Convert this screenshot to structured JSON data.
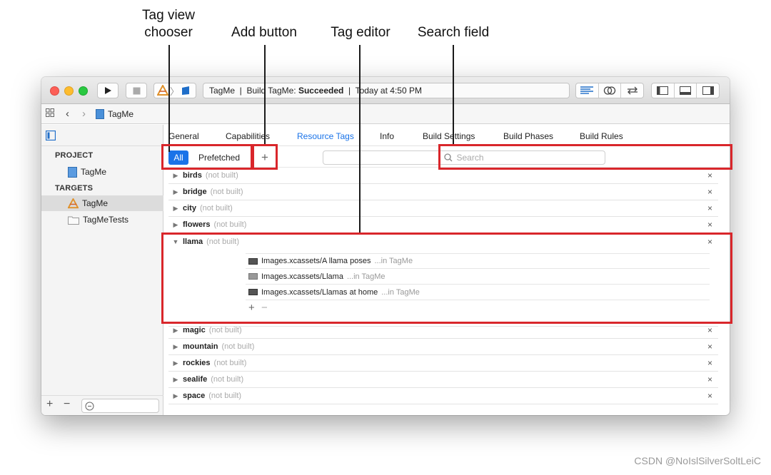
{
  "callouts": {
    "tag_view_chooser": "Tag view\nchooser",
    "add_button": "Add button",
    "tag_editor": "Tag editor",
    "search_field": "Search field"
  },
  "toolbar": {
    "scheme": "TagMe",
    "activity_prefix": "TagMe  |  Build TagMe: ",
    "activity_status": "Succeeded",
    "activity_suffix": "  |  Today at 4:50 PM"
  },
  "navbar": {
    "file": "TagMe"
  },
  "sidebar": {
    "sections": [
      {
        "title": "PROJECT",
        "items": [
          "TagMe"
        ]
      },
      {
        "title": "TARGETS",
        "items": [
          "TagMe",
          "TagMeTests"
        ]
      }
    ],
    "footer": {
      "add": "+",
      "remove": "−"
    }
  },
  "tabs": [
    "General",
    "Capabilities",
    "Resource Tags",
    "Info",
    "Build Settings",
    "Build Phases",
    "Build Rules"
  ],
  "active_tab": "Resource Tags",
  "filter": {
    "all": "All",
    "prefetched": "Prefetched",
    "add": "+",
    "search_placeholder": "Search"
  },
  "tags": [
    {
      "name": "birds",
      "status": "(not built)",
      "expanded": false
    },
    {
      "name": "bridge",
      "status": "(not built)",
      "expanded": false
    },
    {
      "name": "city",
      "status": "(not built)",
      "expanded": false
    },
    {
      "name": "flowers",
      "status": "(not built)",
      "expanded": false
    },
    {
      "name": "llama",
      "status": "(not built)",
      "expanded": true
    },
    {
      "name": "magic",
      "status": "(not built)",
      "expanded": false
    },
    {
      "name": "mountain",
      "status": "(not built)",
      "expanded": false
    },
    {
      "name": "rockies",
      "status": "(not built)",
      "expanded": false
    },
    {
      "name": "sealife",
      "status": "(not built)",
      "expanded": false
    },
    {
      "name": "space",
      "status": "(not built)",
      "expanded": false
    }
  ],
  "remove_glyph": "×",
  "llama_assets": [
    {
      "path": "Images.xcassets/A llama poses",
      "where": "...in TagMe"
    },
    {
      "path": "Images.xcassets/Llama",
      "where": "...in TagMe"
    },
    {
      "path": "Images.xcassets/Llamas at home",
      "where": "...in TagMe"
    }
  ],
  "asset_controls": {
    "add": "+",
    "remove": "−"
  },
  "watermark": "CSDN @NoIslSilverSoltLeiC",
  "colors": {
    "highlight": "#d9262b",
    "accent": "#1a73e8",
    "selected_segment": "#1a73e8"
  }
}
